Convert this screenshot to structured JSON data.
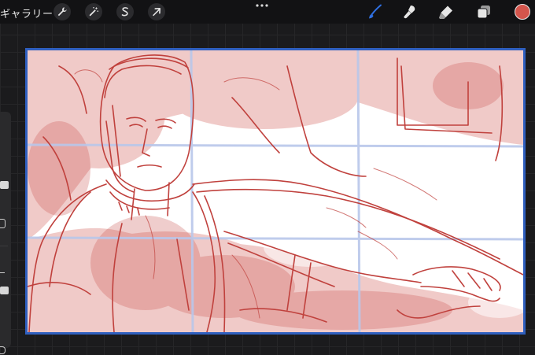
{
  "toolbar": {
    "gallery_label": "ギャラリー",
    "left_tools": [
      "wrench-icon",
      "magic-wand-icon",
      "selection-icon",
      "transform-arrow-icon"
    ],
    "right_tools": [
      "brush-icon",
      "smudge-icon",
      "eraser-icon",
      "layers-icon"
    ],
    "active_tool": "brush-icon",
    "accent_color": "#2f6fe0",
    "current_color": "#d4554c"
  },
  "canvas": {
    "sketch_color": "#c0413d",
    "guide_color": "#b9c7ea",
    "frame_color": "#2f5fbf"
  }
}
